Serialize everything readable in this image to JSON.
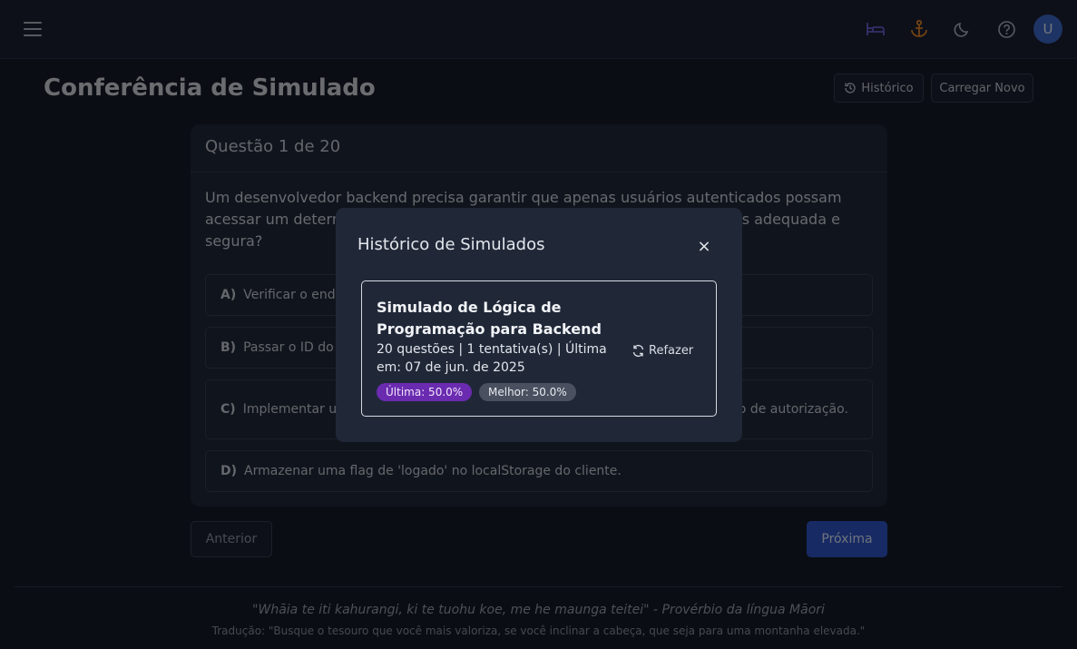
{
  "page": {
    "title": "Conferência de Simulado",
    "history_button": "Histórico",
    "load_button": "Carregar Novo"
  },
  "topbar": {
    "icons": [
      "menu-icon",
      "bed-icon",
      "anchor-icon",
      "moon-icon",
      "help-icon"
    ],
    "avatar_initial": "U"
  },
  "question": {
    "header": "Questão 1 de 20",
    "text": "Um desenvolvedor backend precisa garantir que apenas usuários autenticados possam acessar um determinado recurso. Qual das seguintes abordagens é a mais adequada e segura?",
    "options": [
      {
        "letter": "A)",
        "text": "Verificar o endereço IP do usuário em cada requisição."
      },
      {
        "letter": "B)",
        "text": "Passar o ID do usuário como parâmetro na URL."
      },
      {
        "letter": "C)",
        "text": "Implementar um sistema de autenticação baseado em tokens com mecanismo de autorização."
      },
      {
        "letter": "D)",
        "text": "Armazenar uma flag de 'logado' no localStorage do cliente."
      }
    ]
  },
  "navigation": {
    "previous": "Anterior",
    "next": "Próxima"
  },
  "footer": {
    "quote": "\"Whāia te iti kahurangi, ki te tuohu koe, me he maunga teitei\" - Provérbio da língua Māori",
    "translation": "Tradução: \"Busque o tesouro que você mais valoriza, se você inclinar a cabeça, que seja para uma montanha elevada.\""
  },
  "modal": {
    "title": "Histórico de Simulados",
    "close_symbol": "×",
    "entries": [
      {
        "title": "Simulado de Lógica de Programação para Backend",
        "meta": "20 questões | 1 tentativa(s) | Última em: 07 de jun. de 2025",
        "redo_label": "Refazer",
        "last_badge": "Última: 50.0%",
        "best_badge": "Melhor: 50.0%"
      }
    ]
  },
  "colors": {
    "accent": "#2f55c8",
    "bed_icon": "#6a5fd6",
    "anchor_icon": "#e0822a",
    "badge_last": "#6b2bb0",
    "badge_best": "#4a5060"
  }
}
